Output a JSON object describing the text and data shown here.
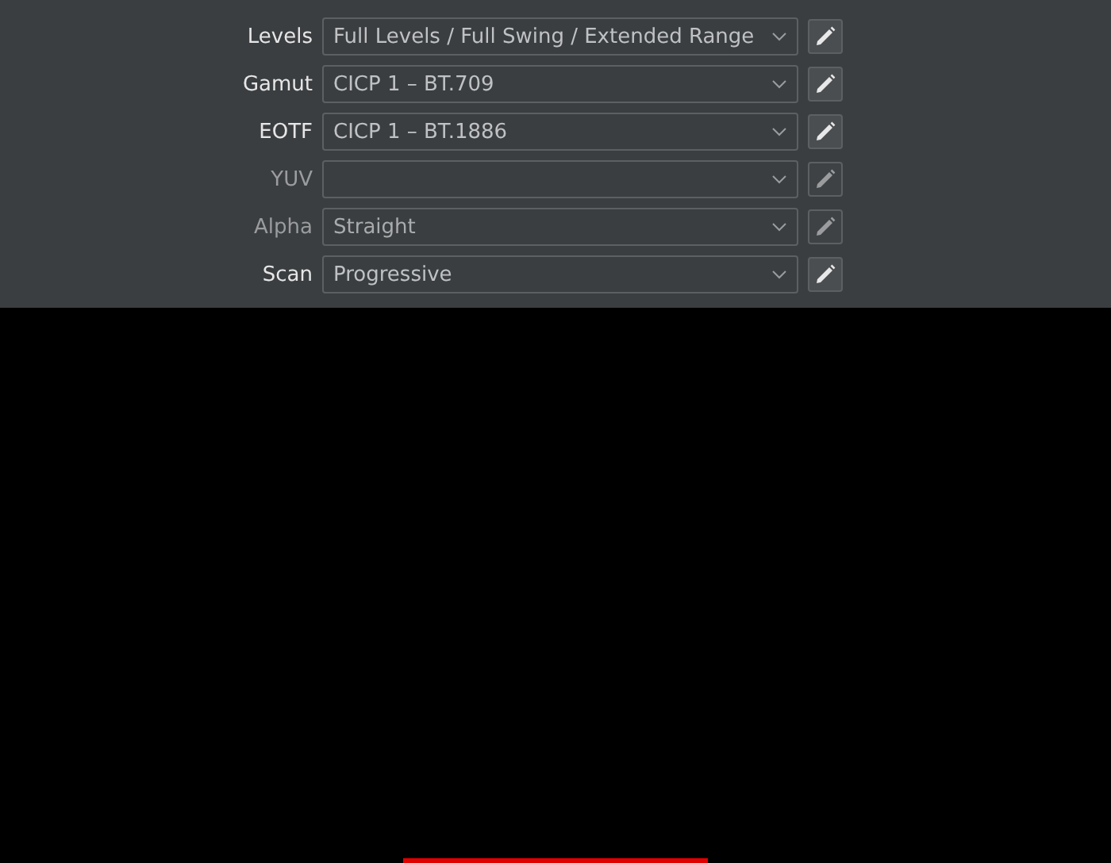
{
  "fields": [
    {
      "label": "Levels",
      "value": "Full Levels / Full Swing / Extended Range",
      "disabled": false
    },
    {
      "label": "Gamut",
      "value": "CICP 1 – BT.709",
      "disabled": false
    },
    {
      "label": "EOTF",
      "value": "CICP 1 – BT.1886",
      "disabled": false
    },
    {
      "label": "YUV",
      "disabled": true
    },
    {
      "label": "Alpha",
      "value": "Straight",
      "disabled": true
    },
    {
      "label": "Scan",
      "value": "Progressive",
      "disabled": false
    }
  ]
}
